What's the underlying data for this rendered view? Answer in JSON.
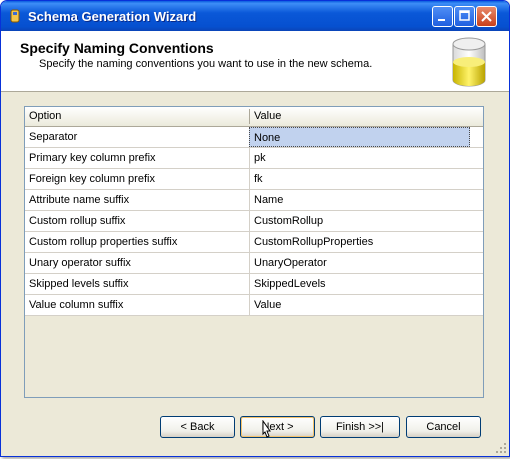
{
  "window": {
    "title": "Schema Generation Wizard"
  },
  "header": {
    "title": "Specify Naming Conventions",
    "subtitle": "Specify the naming conventions you want to use in the new schema."
  },
  "grid": {
    "columns": [
      "Option",
      "Value"
    ],
    "rows": [
      {
        "option": "Separator",
        "value": "None"
      },
      {
        "option": "Primary key column prefix",
        "value": "pk"
      },
      {
        "option": "Foreign key column prefix",
        "value": "fk"
      },
      {
        "option": "Attribute name suffix",
        "value": "Name"
      },
      {
        "option": "Custom rollup suffix",
        "value": "CustomRollup"
      },
      {
        "option": "Custom rollup properties suffix",
        "value": "CustomRollupProperties"
      },
      {
        "option": "Unary operator suffix",
        "value": "UnaryOperator"
      },
      {
        "option": "Skipped levels suffix",
        "value": "SkippedLevels"
      },
      {
        "option": "Value column suffix",
        "value": "Value"
      }
    ]
  },
  "buttons": {
    "back": "< Back",
    "next": "Next >",
    "finish": "Finish >>|",
    "cancel": "Cancel"
  },
  "icons": [
    "wizard-app-icon",
    "minimize-icon",
    "maximize-icon",
    "close-icon",
    "database-cylinder-icon",
    "resize-grip-icon",
    "mouse-pointer-icon"
  ],
  "colors": {
    "titlebar": "#0a58d8",
    "selected_cell": "#c1d2ee",
    "dialog_bg": "#ece9d8"
  }
}
